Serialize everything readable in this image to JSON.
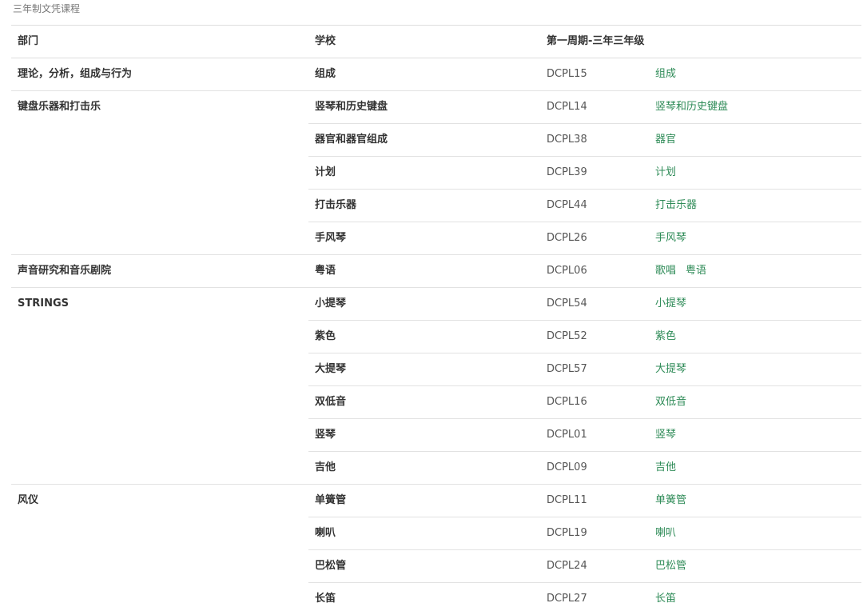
{
  "caption": "三年制文凭课程",
  "headers": {
    "department": "部门",
    "school": "学校",
    "period": "第一周期-三年三年级"
  },
  "link_color": "#2e8b57",
  "rows": [
    {
      "department": "理论，分析，组成与行为",
      "school": "组成",
      "code": "DCPL15",
      "links": [
        "组成"
      ]
    },
    {
      "department": "键盘乐器和打击乐",
      "school": "竖琴和历史键盘",
      "code": "DCPL14",
      "links": [
        "竖琴和历史键盘"
      ]
    },
    {
      "department": "",
      "school": "器官和器官组成",
      "code": "DCPL38",
      "links": [
        "器官"
      ]
    },
    {
      "department": "",
      "school": "计划",
      "code": "DCPL39",
      "links": [
        "计划"
      ]
    },
    {
      "department": "",
      "school": "打击乐器",
      "code": "DCPL44",
      "links": [
        "打击乐器"
      ]
    },
    {
      "department": "",
      "school": "手风琴",
      "code": "DCPL26",
      "links": [
        "手风琴"
      ]
    },
    {
      "department": "声音研究和音乐剧院",
      "school": "粤语",
      "code": "DCPL06",
      "links": [
        "歌唱",
        "粤语"
      ]
    },
    {
      "department": "STRINGS",
      "school": "小提琴",
      "code": "DCPL54",
      "links": [
        "小提琴"
      ]
    },
    {
      "department": "",
      "school": "紫色",
      "code": "DCPL52",
      "links": [
        "紫色"
      ]
    },
    {
      "department": "",
      "school": "大提琴",
      "code": "DCPL57",
      "links": [
        "大提琴"
      ]
    },
    {
      "department": "",
      "school": "双低音",
      "code": "DCPL16",
      "links": [
        "双低音"
      ]
    },
    {
      "department": "",
      "school": "竖琴",
      "code": "DCPL01",
      "links": [
        "竖琴"
      ]
    },
    {
      "department": "",
      "school": "吉他",
      "code": "DCPL09",
      "links": [
        "吉他"
      ]
    },
    {
      "department": "风仪",
      "school": "单簧管",
      "code": "DCPL11",
      "links": [
        "单簧管"
      ]
    },
    {
      "department": "",
      "school": "喇叭",
      "code": "DCPL19",
      "links": [
        "喇叭"
      ]
    },
    {
      "department": "",
      "school": "巴松管",
      "code": "DCPL24",
      "links": [
        "巴松管"
      ]
    },
    {
      "department": "",
      "school": "长笛",
      "code": "DCPL27",
      "links": [
        "长笛"
      ]
    }
  ]
}
